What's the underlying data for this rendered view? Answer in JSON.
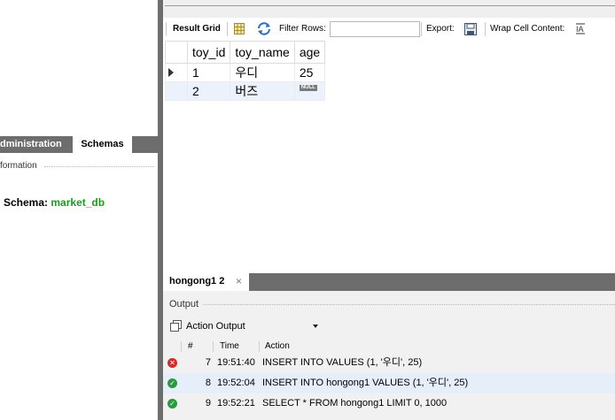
{
  "sidebar": {
    "tabs": [
      {
        "label": "dministration"
      },
      {
        "label": "Schemas"
      }
    ],
    "info_header": "formation",
    "schema_label": "Schema:",
    "schema_value": "market_db"
  },
  "toolbar": {
    "result_grid": "Result Grid",
    "filter_rows": "Filter Rows:",
    "filter_value": "",
    "export": "Export:",
    "wrap_cell": "Wrap Cell Content:"
  },
  "result_grid": {
    "columns": [
      "toy_id",
      "toy_name",
      "age"
    ],
    "rows": [
      {
        "toy_id": "1",
        "toy_name": "우디",
        "age": "25"
      },
      {
        "toy_id": "2",
        "toy_name": "버즈",
        "age": "NULL"
      }
    ]
  },
  "query_tab": {
    "label": "hongong1 2",
    "close": "×"
  },
  "output": {
    "title": "Output",
    "selector": "Action Output",
    "columns": [
      "#",
      "Time",
      "Action"
    ],
    "rows": [
      {
        "status": "error",
        "num": "7",
        "time": "19:51:40",
        "action": "INSERT INTO VALUES (1, '우디', 25)"
      },
      {
        "status": "ok",
        "num": "8",
        "time": "19:52:04",
        "action": "INSERT INTO hongong1 VALUES (1, '우디', 25)"
      },
      {
        "status": "ok",
        "num": "9",
        "time": "19:52:21",
        "action": "SELECT * FROM hongong1 LIMIT 0, 1000"
      }
    ]
  },
  "colors": {
    "schema_value": "#1d9a1d",
    "error": "#d42a2a",
    "ok": "#2b9a3e",
    "tab_bar": "#6d6d6d"
  }
}
